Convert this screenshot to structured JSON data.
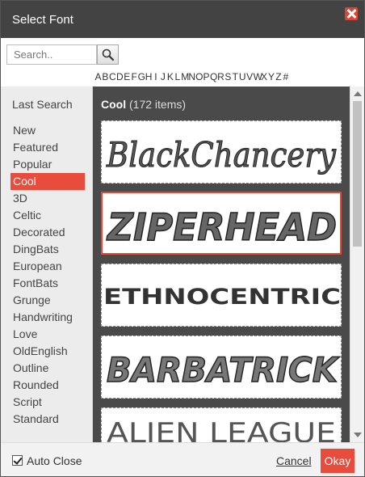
{
  "window": {
    "title": "Select Font"
  },
  "search": {
    "placeholder": "Search.."
  },
  "alphabet": [
    "A",
    "B",
    "C",
    "D",
    "E",
    "F",
    "G",
    "H",
    "I",
    "J",
    "K",
    "L",
    "M",
    "N",
    "O",
    "P",
    "Q",
    "R",
    "S",
    "T",
    "U",
    "V",
    "W",
    "X",
    "Y",
    "Z",
    "#"
  ],
  "sidebar": {
    "last_search": "Last Search",
    "categories": [
      "New",
      "Featured",
      "Popular",
      "Cool",
      "3D",
      "Celtic",
      "Decorated",
      "DingBats",
      "European",
      "FontBats",
      "Grunge",
      "Handwriting",
      "Love",
      "OldEnglish",
      "Outline",
      "Rounded",
      "Script",
      "Standard"
    ],
    "active": "Cool"
  },
  "main": {
    "category": "Cool",
    "count": "(172 items)",
    "fonts": [
      "BlackChancery",
      "ZIPERHEAD",
      "ETHNOCENTRIC",
      "BARBATRICK",
      "ALIEN LEAGUE"
    ],
    "selected": "ZIPERHEAD"
  },
  "footer": {
    "auto_close_label": "Auto Close",
    "auto_close_checked": true,
    "cancel_label": "Cancel",
    "okay_label": "Okay"
  },
  "colors": {
    "titlebar": "#434343",
    "accent": "#e74c3c",
    "panel": "#4a4a4a"
  }
}
